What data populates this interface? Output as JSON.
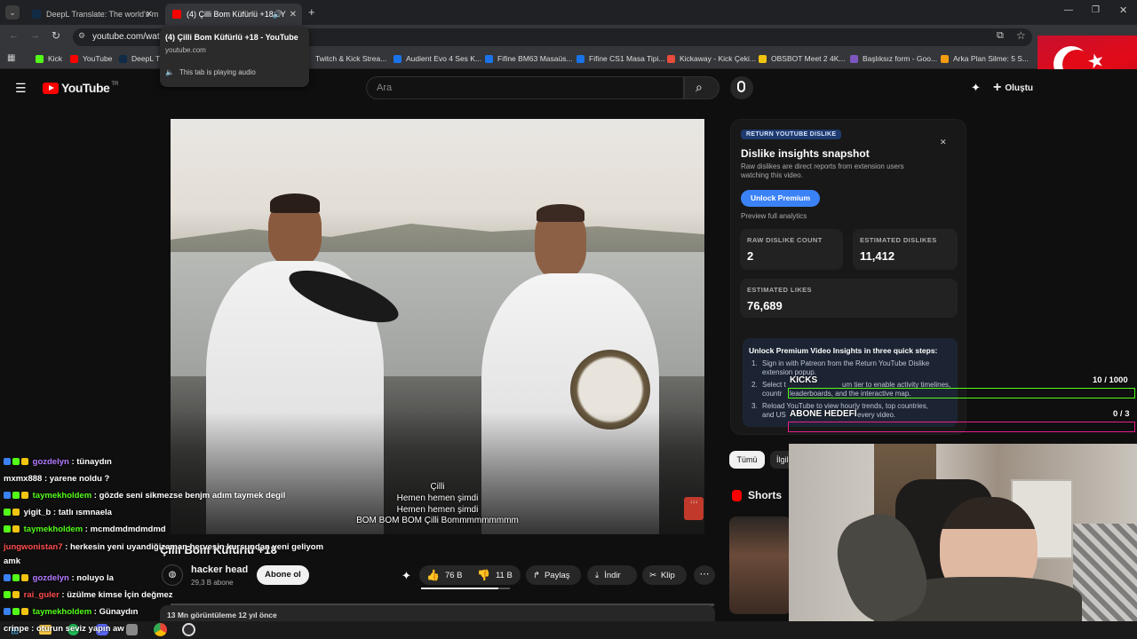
{
  "browser": {
    "tabs": [
      {
        "label": "DeepL Translate: The world's m",
        "active": false
      },
      {
        "label": "(4) Çilli Bom Küfürlü +18 - Y",
        "active": true
      }
    ],
    "url": "youtube.com/wat",
    "tooltip": {
      "title": "(4) Çilli Bom Küfürlü +18 - YouTube",
      "domain": "youtube.com",
      "audio": "This tab is playing audio"
    },
    "bookmarks": [
      {
        "label": "Kick",
        "color": "#53fc18"
      },
      {
        "label": "YouTube",
        "color": "#ff0000"
      },
      {
        "label": "DeepL T",
        "color": "#0f2b46"
      },
      {
        "label": "Twitch & Kick Strea...",
        "color": "#9146ff"
      },
      {
        "label": "Audient Evo 4 Ses K...",
        "color": "#1a73e8"
      },
      {
        "label": "Fifine BM63 Masaüs...",
        "color": "#1a73e8"
      },
      {
        "label": "Fifine CS1 Masa Tipi...",
        "color": "#1a73e8"
      },
      {
        "label": "Kickaway - Kick Çeki...",
        "color": "#e74c3c"
      },
      {
        "label": "OBSBOT Meet 2 4K...",
        "color": "#f1c40f"
      },
      {
        "label": "Başlıksız form - Goo...",
        "color": "#7e57c2"
      },
      {
        "label": "Arka Plan Silme: 5 S...",
        "color": "#f39c12"
      }
    ]
  },
  "youtube": {
    "logo": "YouTube",
    "logo_sup": "TR",
    "search_placeholder": "Ara",
    "create_label": "Oluştu",
    "video": {
      "captions": [
        "Çilli",
        "Hemen hemen şimdi",
        "Hemen hemen şimdi",
        "BOM BOM BOM Çilli Bommmmmmmmm"
      ],
      "title_partial": "Çilli Bom Küfürlü +18",
      "channel": "hacker head",
      "subscribers": "29,3 B abone",
      "subscribe_label": "Abone ol",
      "likes": "76 B",
      "dislikes": "11 B",
      "share": "Paylaş",
      "download": "İndir",
      "clip": "Klip",
      "views_partial": "13 Mn görüntüleme  12 yıl önce"
    },
    "filters": [
      "Tümü",
      "İlgil"
    ],
    "shorts_label": "Shorts"
  },
  "ryd": {
    "tag": "RETURN YOUTUBE DISLIKE",
    "title": "Dislike insights snapshot",
    "desc": "Raw dislikes are direct reports from extension users watching this video.",
    "unlock": "Unlock Premium",
    "preview": "Preview full analytics",
    "raw_label": "RAW DISLIKE COUNT",
    "raw_value": "2",
    "est_dislikes_label": "ESTIMATED DISLIKES",
    "est_dislikes_value": "11,412",
    "est_likes_label": "ESTIMATED LIKES",
    "est_likes_value": "76,689",
    "steps_title": "Unlock Premium Video Insights in three quick steps:",
    "step1": "Sign in with Patreon from the Return YouTube Dislike extension popup.",
    "step2a": "Select t",
    "step2b": "um tier to enable activity timelines,",
    "step2c": "countr",
    "step2d": "leaderboards, and the interactive map.",
    "step3a": "Reload YouTube to view hourly trends, top countries,",
    "step3b": "and US",
    "step3c": "every video."
  },
  "overlay": {
    "kicks_label": "KICKS",
    "kicks_value": "10  / 1000",
    "goal_label": "ABONE HEDEFİ",
    "goal_value": "0  / 3",
    "colors": {
      "kicks": "#53fc18",
      "goal": "#e91e8c"
    }
  },
  "chat": [
    {
      "user": "gozdelyn",
      "msg": "tünaydın",
      "color": "#b57bff"
    },
    {
      "user": "mxmx888",
      "msg": "yarene noldu ?",
      "color": "#ffffff"
    },
    {
      "user": "taymekholdem",
      "msg": "gözde seni sikmezse benjm adım taymek degil",
      "color": "#53fc18"
    },
    {
      "user": "yigit_b",
      "msg": "tatlı ısmnaela",
      "color": "#ffffff"
    },
    {
      "user": "taymekholdem",
      "msg": "mcmdmdmdmdmd",
      "color": "#53fc18"
    },
    {
      "user": "jungwonistan7",
      "msg": "herkesin yeni uyandiğizaman herveşin kursundan yeni geliyom",
      "color": "#ff4d4d"
    },
    {
      "user": "",
      "msg": "amk",
      "color": "#ffffff"
    },
    {
      "user": "gozdelyn",
      "msg": "noluyo la",
      "color": "#b57bff"
    },
    {
      "user": "rai_guler",
      "msg": "üzülme kimse İçin değmez",
      "color": "#ff4d4d"
    },
    {
      "user": "taymekholdem",
      "msg": "Günaydın",
      "color": "#53fc18"
    },
    {
      "user": "crinpe",
      "msg": "oturun seviz yapın aw",
      "color": "#ffffff"
    }
  ]
}
